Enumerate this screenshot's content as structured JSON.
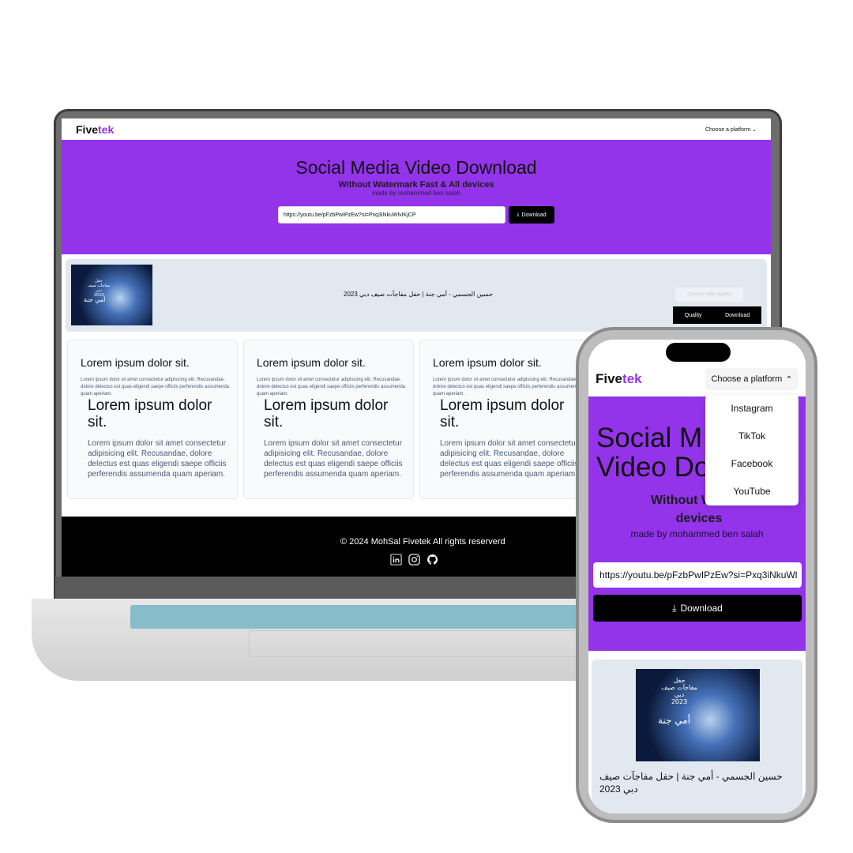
{
  "brand": {
    "part1": "Five",
    "part2": "tek",
    "accent": "#9333ea"
  },
  "desktop": {
    "nav": {
      "platform_label": "Choose a platform"
    },
    "hero": {
      "title": "Social Media Video Download",
      "subtitle": "Without Watermark Fast & All devices",
      "byline": "made by mohammed ben salah",
      "url_value": "https://youtu.be/pFzbPwIPzEw?si=Pxq3iNkuWlvIKjCP",
      "download_label": "Download"
    },
    "result": {
      "video_title": "حسين الجسمي - أمي جنة | حفل مفاجآت صيف دبي 2023",
      "quality_placeholder": "Choose video quality",
      "table_headers": [
        "Quality",
        "Download"
      ]
    },
    "cards": [
      {
        "title": "Lorem ipsum dolor sit.",
        "text": "Lorem ipsum dolor sit amet consectetur adipisicing elit. Recusandae, dolore delectus est quas eligendi saepe officiis perferendis assumenda quam aperiam."
      },
      {
        "title": "Lorem ipsum dolor sit.",
        "text": "Lorem ipsum dolor sit amet consectetur adipisicing elit. Recusandae, dolore delectus est quas eligendi saepe officiis perferendis assumenda quam aperiam."
      },
      {
        "title": "Lorem ipsum dolor sit.",
        "text": "Lorem ipsum dolor sit amet consectetur adipisicing elit. Recusandae, dolore delectus est quas eligendi saepe officiis perferendis assumenda quam aperiam."
      }
    ],
    "cards_overlay": [
      {
        "title": "Lorem ipsum dolor sit.",
        "text": "Lorem ipsum dolor sit amet consectetur adipisicing elit. Recusandae, dolore delectus est quas eligendi saepe officiis perferendis assumenda quam aperiam."
      },
      {
        "title": "Lorem ipsum dolor sit.",
        "text": "Lorem ipsum dolor sit amet consectetur adipisicing elit. Recusandae, dolore delectus est quas eligendi saepe officiis perferendis assumenda quam aperiam."
      },
      {
        "title": "Lorem ipsum dolor sit.",
        "text": "Lorem ipsum dolor sit amet consectetur adipisicing elit. Recusandae, dolore delectus est quas eligendi saepe officiis perferendis assumenda quam aperiam."
      }
    ],
    "footer": {
      "copyright": "© 2024 MohSal Fivetek All rights reserverd",
      "icons": [
        "linkedin-icon",
        "instagram-icon",
        "github-icon"
      ]
    }
  },
  "thumbnail": {
    "line1": "حفل",
    "line2": "مفاجآت صيف دبي",
    "line3": "2023",
    "line4": "أمي جنة"
  },
  "mobile": {
    "nav": {
      "platform_label": "Choose a platform"
    },
    "dropdown": [
      "Instagram",
      "TikTok",
      "Facebook",
      "YouTube"
    ],
    "hero": {
      "title_visible": "Social M\nVideo Do",
      "subtitle_visible": "Without Waterm\ndevices",
      "byline": "made by mohammed ben salah",
      "url_value": "https://youtu.be/pFzbPwIPzEw?si=Pxq3iNkuWl",
      "download_label": "Download"
    },
    "result": {
      "video_title": "حسين الجسمي - أمي جنة | حفل مفاجآت صيف دبي 2023"
    }
  }
}
